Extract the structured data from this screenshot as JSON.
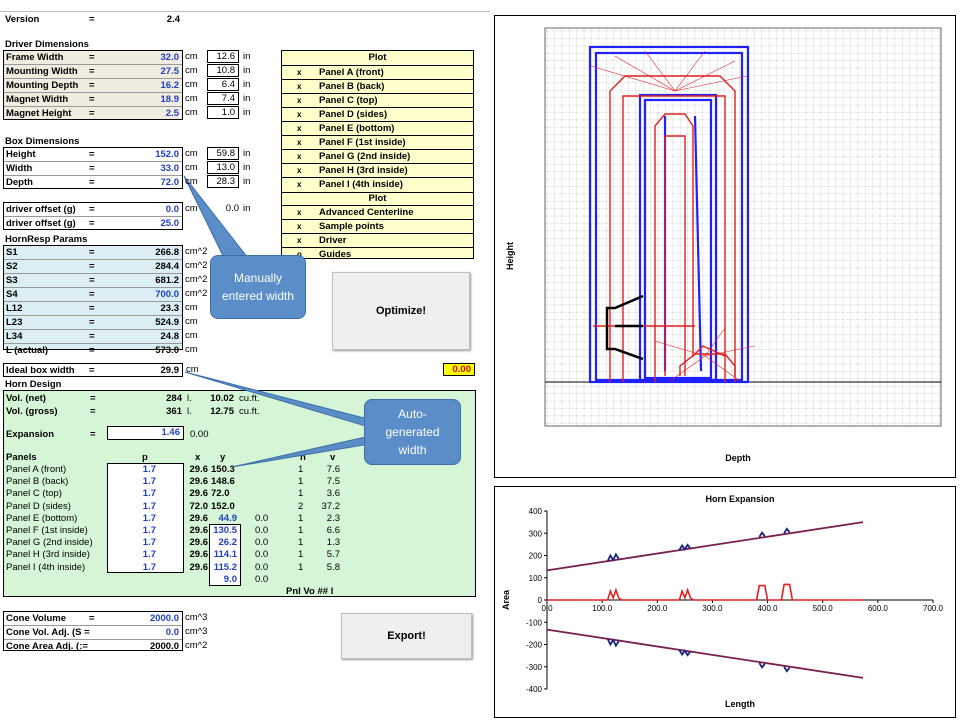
{
  "version": {
    "label": "Version",
    "eq": "=",
    "value": "2.4"
  },
  "driver": {
    "title": "Driver Dimensions",
    "rows": [
      {
        "label": "Frame Width",
        "eq": "=",
        "value": "32.0",
        "unit": "cm",
        "alt": "12.6",
        "alt_unit": "in"
      },
      {
        "label": "Mounting Width",
        "eq": "=",
        "value": "27.5",
        "unit": "cm",
        "alt": "10.8",
        "alt_unit": "in"
      },
      {
        "label": "Mounting Depth",
        "eq": "=",
        "value": "16.2",
        "unit": "cm",
        "alt": "6.4",
        "alt_unit": "in"
      },
      {
        "label": "Magnet Width",
        "eq": "=",
        "value": "18.9",
        "unit": "cm",
        "alt": "7.4",
        "alt_unit": "in"
      },
      {
        "label": "Magnet Height",
        "eq": "=",
        "value": "2.5",
        "unit": "cm",
        "alt": "1.0",
        "alt_unit": "in"
      }
    ]
  },
  "box": {
    "title": "Box Dimensions",
    "rows": [
      {
        "label": "Height",
        "eq": "=",
        "value": "152.0",
        "unit": "cm",
        "alt": "59.8",
        "alt_unit": "in"
      },
      {
        "label": "Width",
        "eq": "=",
        "value": "33.0",
        "unit": "cm",
        "alt": "13.0",
        "alt_unit": "in"
      },
      {
        "label": "Depth",
        "eq": "=",
        "value": "72.0",
        "unit": "cm",
        "alt": "28.3",
        "alt_unit": "in"
      }
    ]
  },
  "offsets": [
    {
      "label": "driver offset (g)",
      "eq": "=",
      "value": "0.0",
      "unit": "cm",
      "alt": "0.0",
      "alt_unit": "in"
    },
    {
      "label": "driver offset (g)",
      "eq": "=",
      "value": "25.0"
    }
  ],
  "hornresp": {
    "title": "HornResp Params",
    "rows": [
      {
        "label": "S1",
        "eq": "=",
        "value": "266.8",
        "unit": "cm^2"
      },
      {
        "label": "S2",
        "eq": "=",
        "value": "284.4",
        "unit": "cm^2"
      },
      {
        "label": "S3",
        "eq": "=",
        "value": "681.2",
        "unit": "cm^2"
      },
      {
        "label": "S4",
        "eq": "=",
        "value": "700.0",
        "unit": "cm^2"
      },
      {
        "label": "L12",
        "eq": "=",
        "value": "23.3",
        "unit": "cm"
      },
      {
        "label": "L23",
        "eq": "=",
        "value": "524.9",
        "unit": "cm"
      },
      {
        "label": "L34",
        "eq": "=",
        "value": "24.8",
        "unit": "cm"
      },
      {
        "label": "L (actual)",
        "eq": "=",
        "value": "573.0",
        "unit": "cm"
      }
    ]
  },
  "ideal": {
    "label": "Ideal box width",
    "eq": "=",
    "value": "29.9",
    "unit": "cm",
    "flag": "0.00"
  },
  "horn": {
    "title": "Horn Design",
    "vol_net": {
      "label": "Vol. (net)",
      "eq": "=",
      "value": "284",
      "unit": "l.",
      "alt": "10.02",
      "alt_unit": "cu.ft."
    },
    "vol_gross": {
      "label": "Vol. (gross)",
      "eq": "=",
      "value": "361",
      "unit": "l.",
      "alt": "12.75",
      "alt_unit": "cu.ft."
    },
    "expansion": {
      "label": "Expansion",
      "eq": "=",
      "value": "1.46",
      "alt": "0.00"
    },
    "headers": {
      "panels": "Panels",
      "p": "p",
      "x": "x",
      "y": "y",
      "n": "n",
      "v": "v"
    },
    "rows": [
      {
        "name": "Panel A (front)",
        "p": "1.7",
        "x": "29.6",
        "y": "150.3",
        "e": "",
        "n": "1",
        "v": "7.6"
      },
      {
        "name": "Panel B (back)",
        "p": "1.7",
        "x": "29.6",
        "y": "148.6",
        "e": "",
        "n": "1",
        "v": "7.5"
      },
      {
        "name": "Panel C (top)",
        "p": "1.7",
        "x": "29.6",
        "y": "72.0",
        "e": "",
        "n": "1",
        "v": "3.6"
      },
      {
        "name": "Panel D (sides)",
        "p": "1.7",
        "x": "72.0",
        "y": "152.0",
        "e": "",
        "n": "2",
        "v": "37.2"
      },
      {
        "name": "Panel E (bottom)",
        "p": "1.7",
        "x": "29.6",
        "y": "44.9",
        "e": "0.0",
        "n": "1",
        "v": "2.3"
      },
      {
        "name": "Panel F (1st inside)",
        "p": "1.7",
        "x": "29.6",
        "y": "130.5",
        "e": "0.0",
        "n": "1",
        "v": "6.6"
      },
      {
        "name": "Panel G (2nd inside)",
        "p": "1.7",
        "x": "29.6",
        "y": "26.2",
        "e": "0.0",
        "n": "1",
        "v": "1.3"
      },
      {
        "name": "Panel H (3rd inside)",
        "p": "1.7",
        "x": "29.6",
        "y": "114.1",
        "e": "0.0",
        "n": "1",
        "v": "5.7"
      },
      {
        "name": "Panel I (4th inside)",
        "p": "1.7",
        "x": "29.6",
        "y": "115.2",
        "e": "0.0",
        "n": "1",
        "v": "5.8"
      }
    ],
    "extra_y": "9.0",
    "extra_e": "0.0",
    "footer": "Pnl Vo  ##  l"
  },
  "cone": [
    {
      "label": "Cone Volume",
      "eq": "=",
      "value": "2000.0",
      "unit": "cm^3"
    },
    {
      "label": "Cone Vol. Adj. (S =",
      "value": "0.0",
      "unit": "cm^3"
    },
    {
      "label": "Cone Area Adj. (:=",
      "value": "2000.0",
      "unit": "cm^2"
    }
  ],
  "plot_menu": {
    "title": "Plot",
    "items": [
      {
        "mark": "x",
        "label": "Panel A (front)"
      },
      {
        "mark": "x",
        "label": "Panel B (back)"
      },
      {
        "mark": "x",
        "label": "Panel C (top)"
      },
      {
        "mark": "x",
        "label": "Panel D (sides)"
      },
      {
        "mark": "x",
        "label": "Panel E (bottom)"
      },
      {
        "mark": "x",
        "label": "Panel F (1st inside)"
      },
      {
        "mark": "x",
        "label": "Panel G (2nd inside)"
      },
      {
        "mark": "x",
        "label": "Panel H (3rd inside)"
      },
      {
        "mark": "x",
        "label": "Panel I (4th inside)"
      }
    ],
    "title2": "Plot",
    "items2": [
      {
        "mark": "x",
        "label": "Advanced Centerline"
      },
      {
        "mark": "x",
        "label": "Sample points"
      },
      {
        "mark": "x",
        "label": "Driver"
      },
      {
        "mark": "o",
        "label": "Guides"
      }
    ]
  },
  "buttons": {
    "optimize": "Optimize!",
    "export": "Export!"
  },
  "callouts": {
    "manual": "Manually entered width",
    "auto": "Auto-generated width"
  },
  "layout_plot": {
    "xlabel": "Depth",
    "ylabel": "Height"
  },
  "chart_data": {
    "type": "line",
    "title": "Horn Expansion",
    "xlabel": "Length",
    "ylabel": "Area",
    "xlim": [
      0,
      700
    ],
    "ylim": [
      -400,
      400
    ],
    "xticks": [
      "0.0",
      "100.0",
      "200.0",
      "300.0",
      "400.0",
      "500.0",
      "600.0",
      "700.0"
    ],
    "yticks": [
      "400",
      "300",
      "200",
      "100",
      "0",
      "-100",
      "-200",
      "-300",
      "-400"
    ],
    "series": [
      {
        "color": "#7a1f4f",
        "x": [
          0,
          573
        ],
        "y": [
          133,
          350
        ]
      },
      {
        "color": "#7a1f4f",
        "x": [
          0,
          573
        ],
        "y": [
          -133,
          -350
        ]
      },
      {
        "color": "#1a237e",
        "x": [
          110,
          115,
          120,
          125,
          130,
          240,
          245,
          250,
          255,
          260,
          385,
          390,
          395,
          430,
          435,
          440
        ],
        "y": [
          175,
          200,
          180,
          205,
          185,
          225,
          245,
          228,
          248,
          232,
          283,
          303,
          287,
          300,
          320,
          304
        ]
      },
      {
        "color": "#1a237e",
        "x": [
          110,
          115,
          120,
          125,
          130,
          240,
          245,
          250,
          255,
          260,
          385,
          390,
          395,
          430,
          435,
          440
        ],
        "y": [
          -175,
          -200,
          -180,
          -205,
          -185,
          -225,
          -245,
          -228,
          -248,
          -232,
          -283,
          -303,
          -287,
          -300,
          -320,
          -304
        ]
      },
      {
        "color": "#e02020",
        "x": [
          0,
          110,
          115,
          120,
          125,
          130,
          135,
          240,
          245,
          250,
          255,
          260,
          265,
          380,
          385,
          395,
          400,
          425,
          430,
          440,
          445,
          573
        ],
        "y": [
          0,
          0,
          40,
          10,
          45,
          10,
          0,
          0,
          40,
          10,
          45,
          10,
          0,
          0,
          65,
          65,
          0,
          0,
          70,
          70,
          0,
          0
        ]
      }
    ]
  }
}
